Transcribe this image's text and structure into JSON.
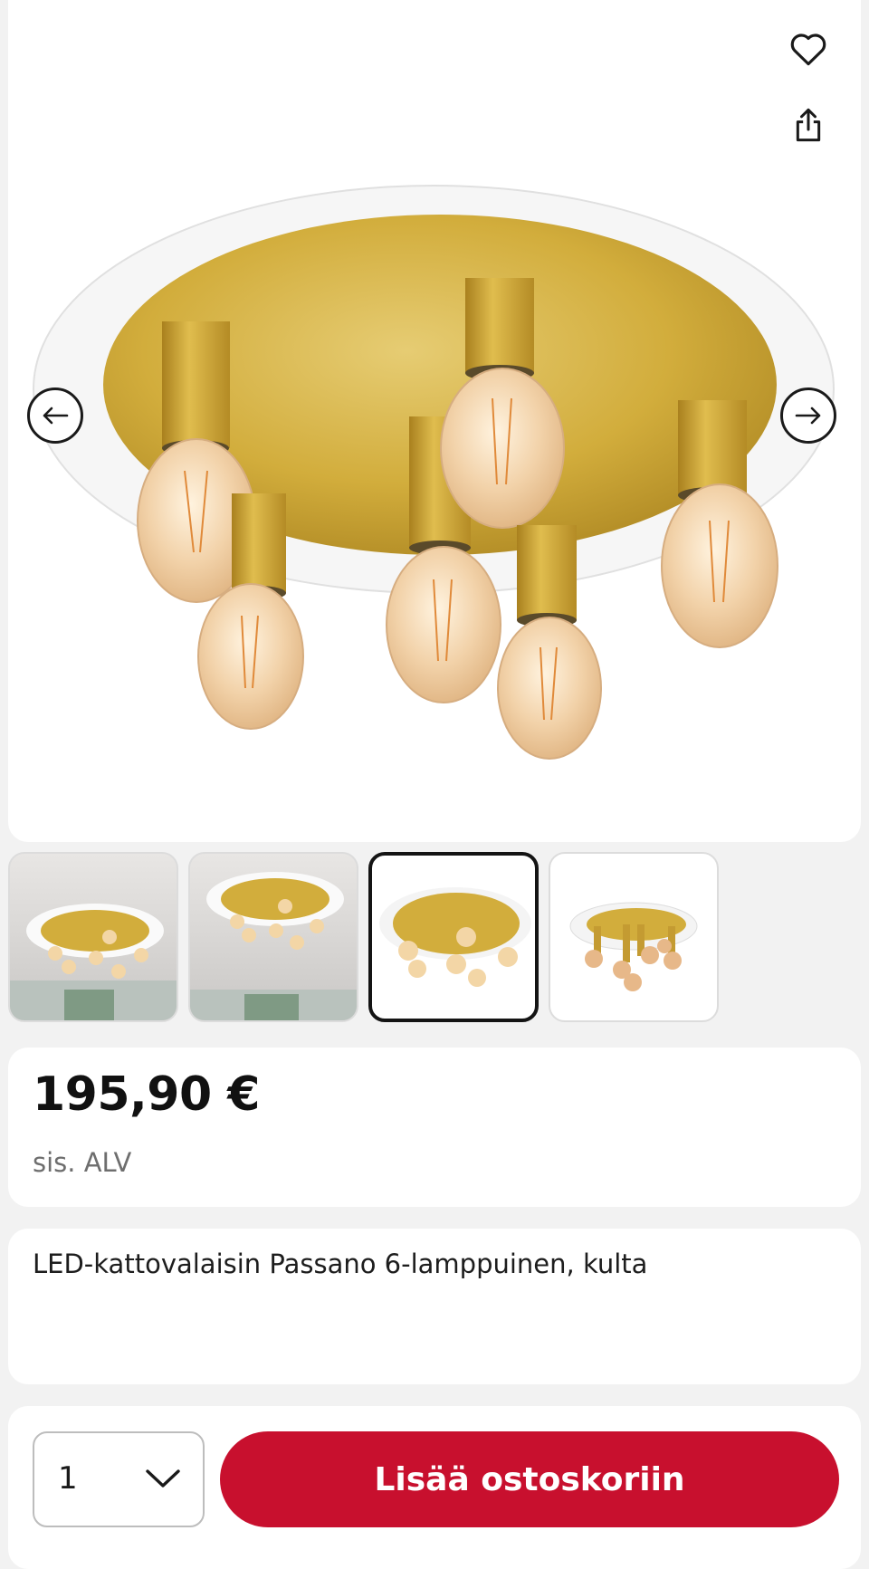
{
  "product": {
    "price": "195,90 €",
    "vat_note": "sis. ALV",
    "title": "LED-kattovalaisin Passano 6-lamppuinen, kulta"
  },
  "purchase": {
    "quantity": "1",
    "add_to_cart_label": "Lisää ostoskoriin"
  },
  "gallery": {
    "thumbnail_count": 4,
    "active_index": 2
  },
  "icons": {
    "favorite": "heart-icon",
    "share": "share-icon",
    "prev": "arrow-left-icon",
    "next": "arrow-right-icon",
    "quantity_dropdown": "chevron-down-icon"
  },
  "colors": {
    "accent": "#c8102e",
    "background": "#f2f2f2",
    "card": "#ffffff",
    "gold": "#d2ad3c"
  }
}
